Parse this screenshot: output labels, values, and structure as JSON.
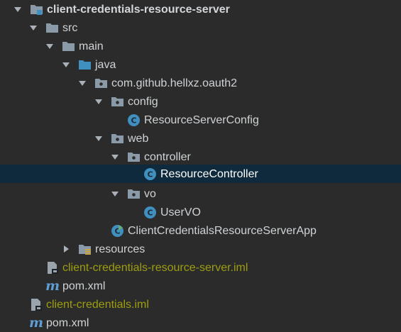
{
  "tree": {
    "items": [
      {
        "label": "client-credentials-resource-server",
        "icon": "module-folder-icon",
        "expand": "expanded"
      },
      {
        "label": "src",
        "icon": "folder-icon",
        "expand": "expanded"
      },
      {
        "label": "main",
        "icon": "folder-icon",
        "expand": "expanded"
      },
      {
        "label": "java",
        "icon": "source-root-folder-icon",
        "expand": "expanded"
      },
      {
        "label": "com.github.hellxz.oauth2",
        "icon": "package-icon",
        "expand": "expanded"
      },
      {
        "label": "config",
        "icon": "package-icon",
        "expand": "expanded"
      },
      {
        "label": "ResourceServerConfig",
        "icon": "class-icon",
        "expand": "none"
      },
      {
        "label": "web",
        "icon": "package-icon",
        "expand": "expanded"
      },
      {
        "label": "controller",
        "icon": "package-icon",
        "expand": "expanded"
      },
      {
        "label": "ResourceController",
        "icon": "class-icon",
        "expand": "none",
        "selected": true
      },
      {
        "label": "vo",
        "icon": "package-icon",
        "expand": "expanded"
      },
      {
        "label": "UserVO",
        "icon": "class-icon",
        "expand": "none"
      },
      {
        "label": "ClientCredentialsResourceServerApp",
        "icon": "spring-boot-class-icon",
        "expand": "none"
      },
      {
        "label": "resources",
        "icon": "resources-folder-icon",
        "expand": "collapsed"
      },
      {
        "label": "client-credentials-resource-server.iml",
        "icon": "iml-file-icon",
        "expand": "none",
        "color": "#9e9e0f"
      },
      {
        "label": "pom.xml",
        "icon": "maven-icon",
        "expand": "none"
      },
      {
        "label": "client-credentials.iml",
        "icon": "iml-file-icon",
        "expand": "none",
        "color": "#9e9e0f"
      },
      {
        "label": "pom.xml",
        "icon": "maven-icon",
        "expand": "none"
      }
    ]
  },
  "colors": {
    "background": "#2b2b2b",
    "selection": "#0e2a3c",
    "text": "#cfd3d6",
    "iml_text": "#9e9e0f",
    "folder": "#8a9aa8",
    "class_icon": "#3f8fbf",
    "maven_icon": "#5f9ed6"
  }
}
